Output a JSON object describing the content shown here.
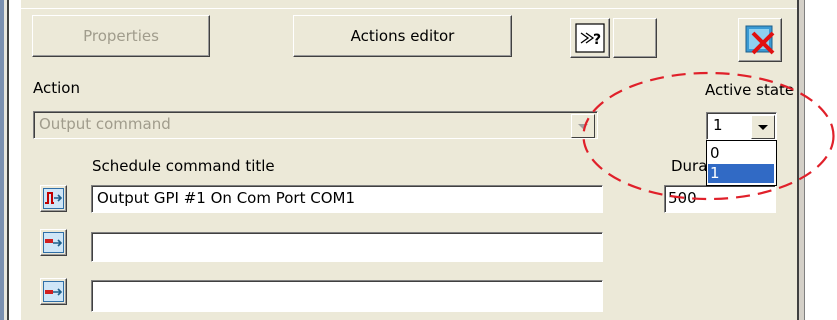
{
  "toolbar": {
    "properties_label": "Properties",
    "actions_editor_label": "Actions editor"
  },
  "action": {
    "label": "Action",
    "value": "Output command"
  },
  "active_state": {
    "label": "Active state",
    "selected": "1",
    "options": [
      "0",
      "1"
    ],
    "highlighted_option": "1"
  },
  "schedule": {
    "title_label": "Schedule command title",
    "duration_label": "Dura",
    "rows": [
      {
        "title": "Output GPI #1 On Com Port COM1",
        "duration": "500"
      },
      {
        "title": ""
      },
      {
        "title": ""
      }
    ]
  },
  "icons": {
    "help": "help-arrow-icon",
    "delete": "delete-x-icon",
    "pulse": "pulse-command-icon",
    "send": "send-command-icon"
  },
  "colors": {
    "panel_bg": "#ece9d8",
    "selection": "#316ac5",
    "annotation": "#e0202a",
    "frame_blue": "#7a8fb0"
  }
}
